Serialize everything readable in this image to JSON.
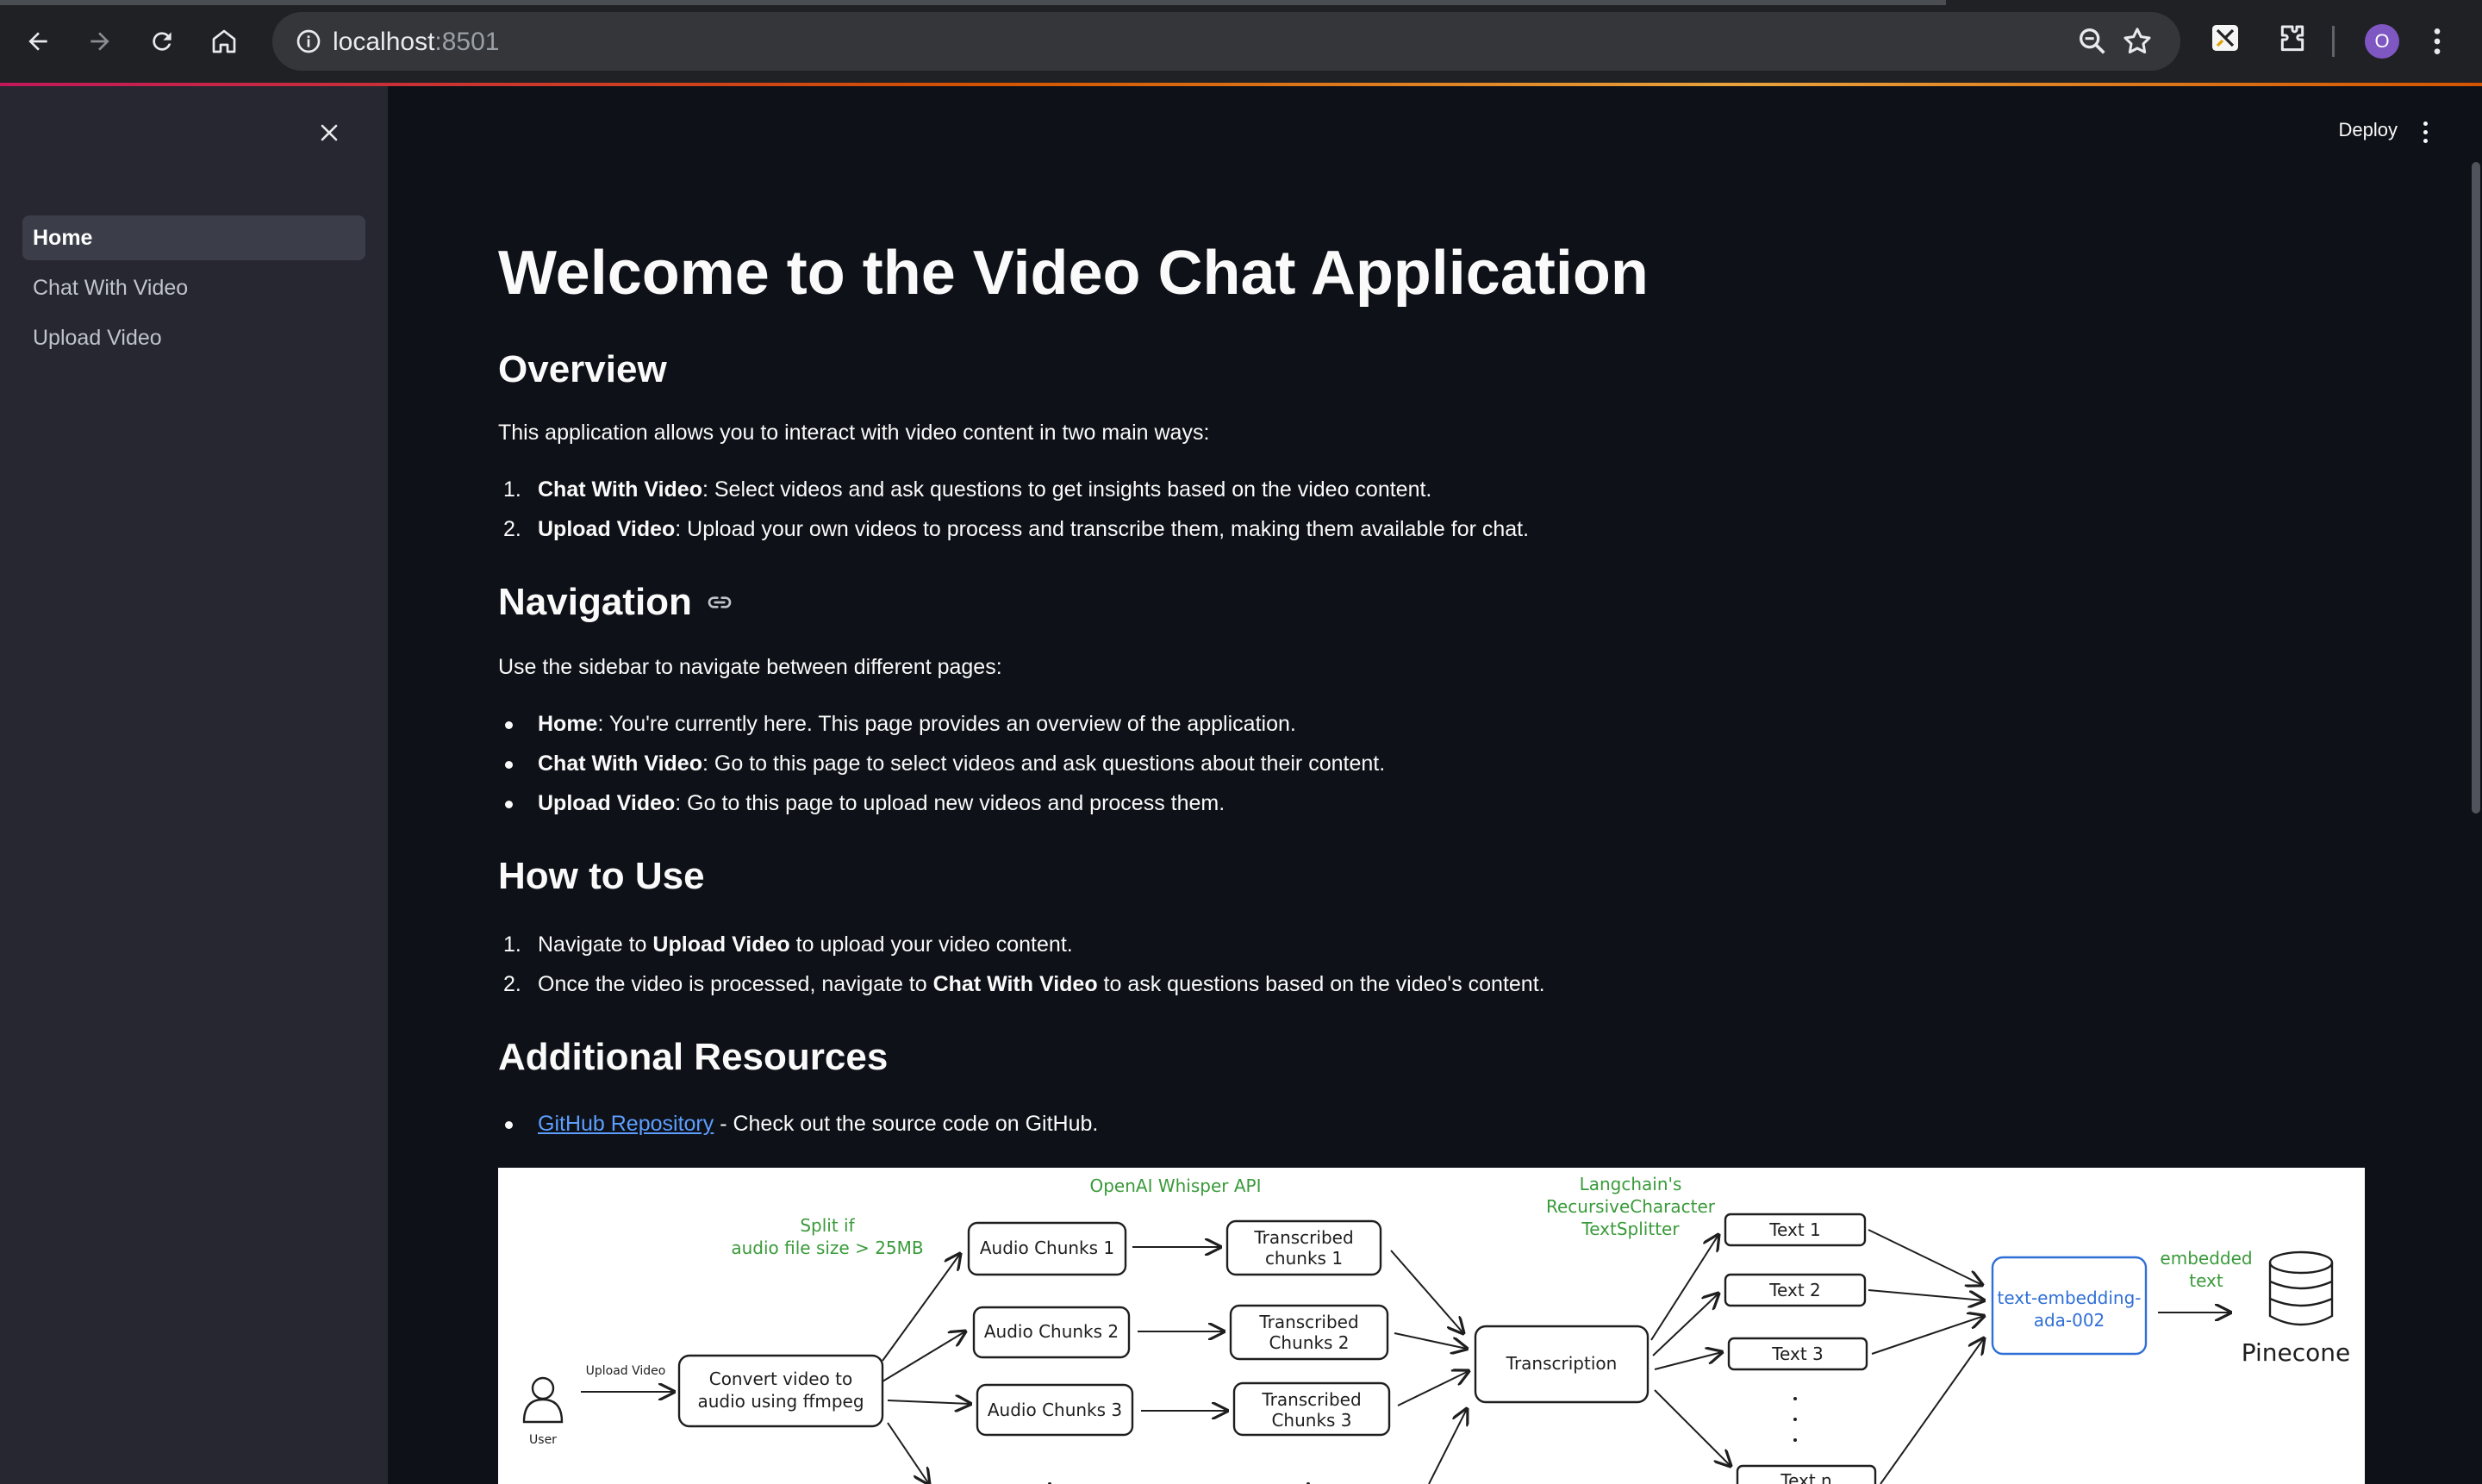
{
  "browser": {
    "url_host": "localhost",
    "url_port": ":8501",
    "avatar_letter": "O"
  },
  "sidebar": {
    "items": [
      {
        "label": "Home",
        "active": true
      },
      {
        "label": "Chat With Video",
        "active": false
      },
      {
        "label": "Upload Video",
        "active": false
      }
    ]
  },
  "header": {
    "deploy_label": "Deploy"
  },
  "main": {
    "title": "Welcome to the Video Chat Application",
    "overview": {
      "heading": "Overview",
      "intro": "This application allows you to interact with video content in two main ways:",
      "items": [
        {
          "marker": "1.",
          "bold": "Chat With Video",
          "text": ": Select videos and ask questions to get insights based on the video content."
        },
        {
          "marker": "2.",
          "bold": "Upload Video",
          "text": ": Upload your own videos to process and transcribe them, making them available for chat."
        }
      ]
    },
    "navigation": {
      "heading": "Navigation",
      "intro": "Use the sidebar to navigate between different pages:",
      "items": [
        {
          "bold": "Home",
          "text": ": You're currently here. This page provides an overview of the application."
        },
        {
          "bold": "Chat With Video",
          "text": ": Go to this page to select videos and ask questions about their content."
        },
        {
          "bold": "Upload Video",
          "text": ": Go to this page to upload new videos and process them."
        }
      ]
    },
    "how_to_use": {
      "heading": "How to Use",
      "items": [
        {
          "marker": "1.",
          "pre": "Navigate to ",
          "bold": "Upload Video",
          "post": " to upload your video content."
        },
        {
          "marker": "2.",
          "pre": "Once the video is processed, navigate to ",
          "bold": "Chat With Video",
          "post": " to ask questions based on the video's content."
        }
      ]
    },
    "resources": {
      "heading": "Additional Resources",
      "link_label": "GitHub Repository",
      "link_suffix": " - Check out the source code on GitHub."
    }
  },
  "diagram": {
    "user_label": "User",
    "upload_label": "Upload Video",
    "convert_label": [
      "Convert video to",
      "audio using ffmpeg"
    ],
    "split_label": [
      "Split if",
      "audio file size > 25MB"
    ],
    "whisper_label": "OpenAI Whisper API",
    "audio_chunks": [
      "Audio Chunks 1",
      "Audio Chunks 2",
      "Audio Chunks 3"
    ],
    "transcribed_chunks": [
      [
        "Transcribed",
        "chunks 1"
      ],
      [
        "Transcribed",
        "Chunks 2"
      ],
      [
        "Transcribed",
        "Chunks 3"
      ]
    ],
    "transcription_label": "Transcription",
    "splitter_label": [
      "Langchain's",
      "RecursiveCharacter",
      "TextSplitter"
    ],
    "texts": [
      "Text 1",
      "Text 2",
      "Text 3",
      "Text n"
    ],
    "embedding_label": [
      "text-embedding-",
      "ada-002"
    ],
    "embedded_label": [
      "embedded",
      "text"
    ],
    "pinecone_label": "Pinecone",
    "colors": {
      "green": "#3a9a3a",
      "blue": "#2f6fd6",
      "ink": "#1e1e1e"
    }
  }
}
